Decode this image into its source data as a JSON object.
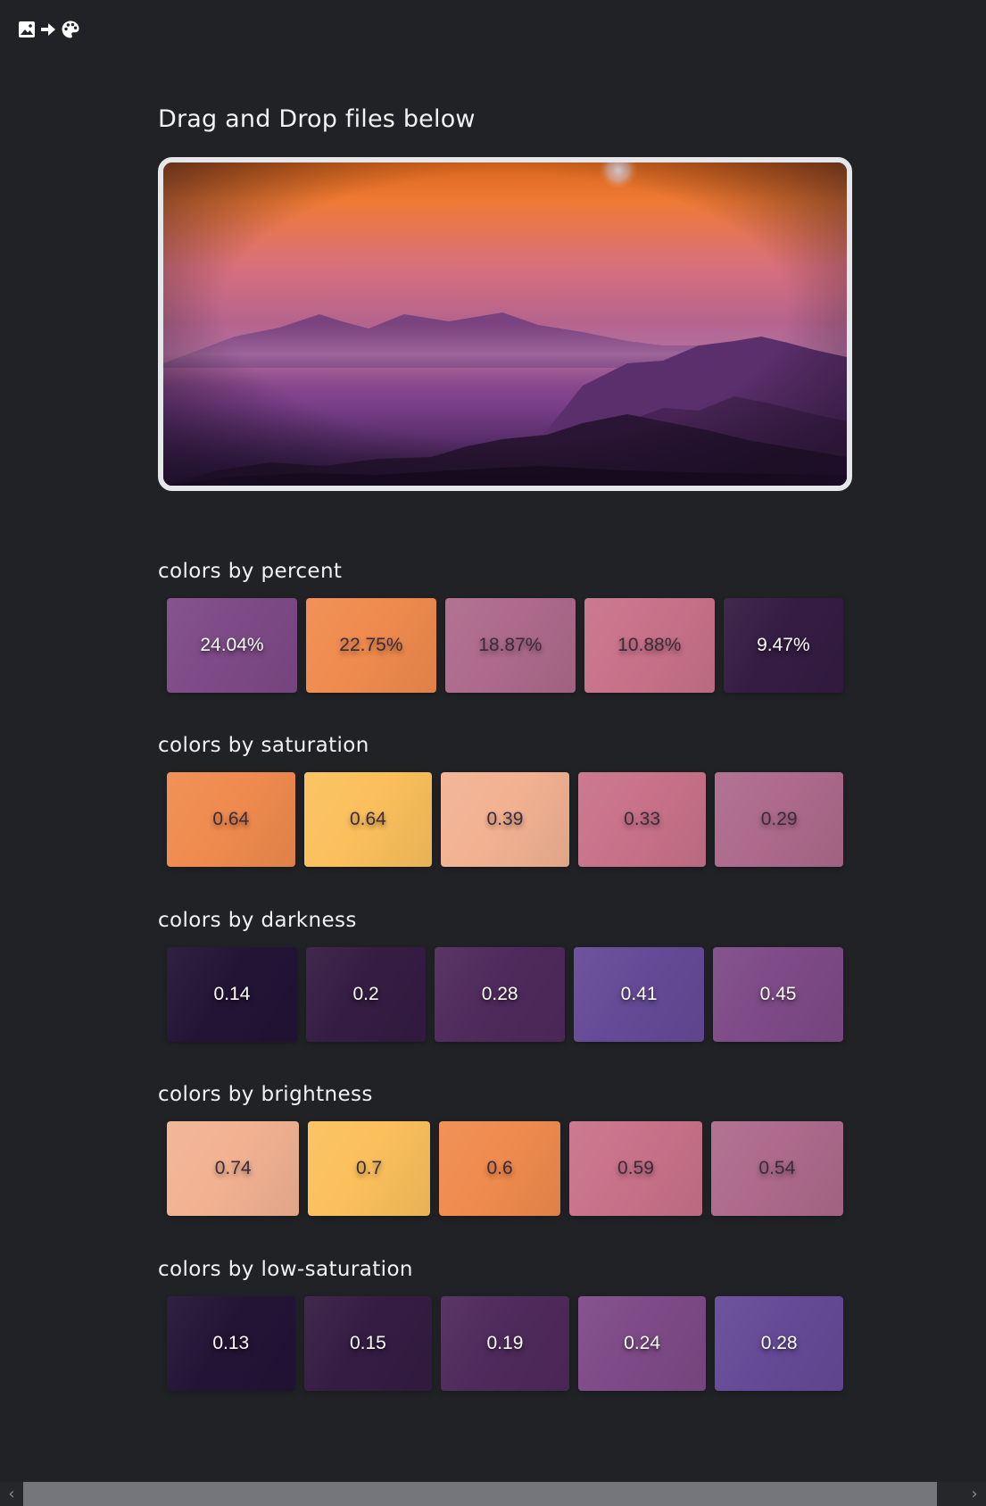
{
  "logo": {
    "icons": [
      "image-icon",
      "arrow-right-icon",
      "palette-icon"
    ]
  },
  "dropzone": {
    "title": "Drag and Drop files below"
  },
  "sections": [
    {
      "title": "colors by percent",
      "swatches": [
        {
          "label": "24.04%",
          "color": "#7e4a87",
          "dark_text": false,
          "flex": 1
        },
        {
          "label": "22.75%",
          "color": "#f08b4e",
          "dark_text": true,
          "flex": 1
        },
        {
          "label": "18.87%",
          "color": "#ad6a8c",
          "dark_text": true,
          "flex": 1
        },
        {
          "label": "10.88%",
          "color": "#c8728a",
          "dark_text": true,
          "flex": 1
        },
        {
          "label": "9.47%",
          "color": "#351c43",
          "dark_text": false,
          "flex": 0.92
        }
      ]
    },
    {
      "title": "colors by saturation",
      "swatches": [
        {
          "label": "0.64",
          "color": "#f08b4e",
          "dark_text": true,
          "flex": 1
        },
        {
          "label": "0.64",
          "color": "#fbc05c",
          "dark_text": true,
          "flex": 1
        },
        {
          "label": "0.39",
          "color": "#f2b292",
          "dark_text": true,
          "flex": 1
        },
        {
          "label": "0.33",
          "color": "#c8728a",
          "dark_text": true,
          "flex": 1
        },
        {
          "label": "0.29",
          "color": "#ad6a8c",
          "dark_text": true,
          "flex": 1
        }
      ]
    },
    {
      "title": "colors by darkness",
      "swatches": [
        {
          "label": "0.14",
          "color": "#221435",
          "dark_text": false,
          "flex": 1
        },
        {
          "label": "0.2",
          "color": "#351c43",
          "dark_text": false,
          "flex": 0.92
        },
        {
          "label": "0.28",
          "color": "#4f2a5c",
          "dark_text": false,
          "flex": 1
        },
        {
          "label": "0.41",
          "color": "#654a97",
          "dark_text": false,
          "flex": 1
        },
        {
          "label": "0.45",
          "color": "#7e4a87",
          "dark_text": false,
          "flex": 1
        }
      ]
    },
    {
      "title": "colors by brightness",
      "swatches": [
        {
          "label": "0.74",
          "color": "#f2b292",
          "dark_text": true,
          "flex": 1
        },
        {
          "label": "0.7",
          "color": "#fbc05c",
          "dark_text": true,
          "flex": 0.92
        },
        {
          "label": "0.6",
          "color": "#f08b4e",
          "dark_text": true,
          "flex": 0.92
        },
        {
          "label": "0.59",
          "color": "#c8728a",
          "dark_text": true,
          "flex": 1
        },
        {
          "label": "0.54",
          "color": "#ad6a8c",
          "dark_text": true,
          "flex": 1
        }
      ]
    },
    {
      "title": "colors by low-saturation",
      "swatches": [
        {
          "label": "0.13",
          "color": "#221435",
          "dark_text": false,
          "flex": 1
        },
        {
          "label": "0.15",
          "color": "#351c43",
          "dark_text": false,
          "flex": 1
        },
        {
          "label": "0.19",
          "color": "#4f2a5c",
          "dark_text": false,
          "flex": 1
        },
        {
          "label": "0.24",
          "color": "#7e4a87",
          "dark_text": false,
          "flex": 1
        },
        {
          "label": "0.28",
          "color": "#654a97",
          "dark_text": false,
          "flex": 1
        }
      ]
    }
  ]
}
